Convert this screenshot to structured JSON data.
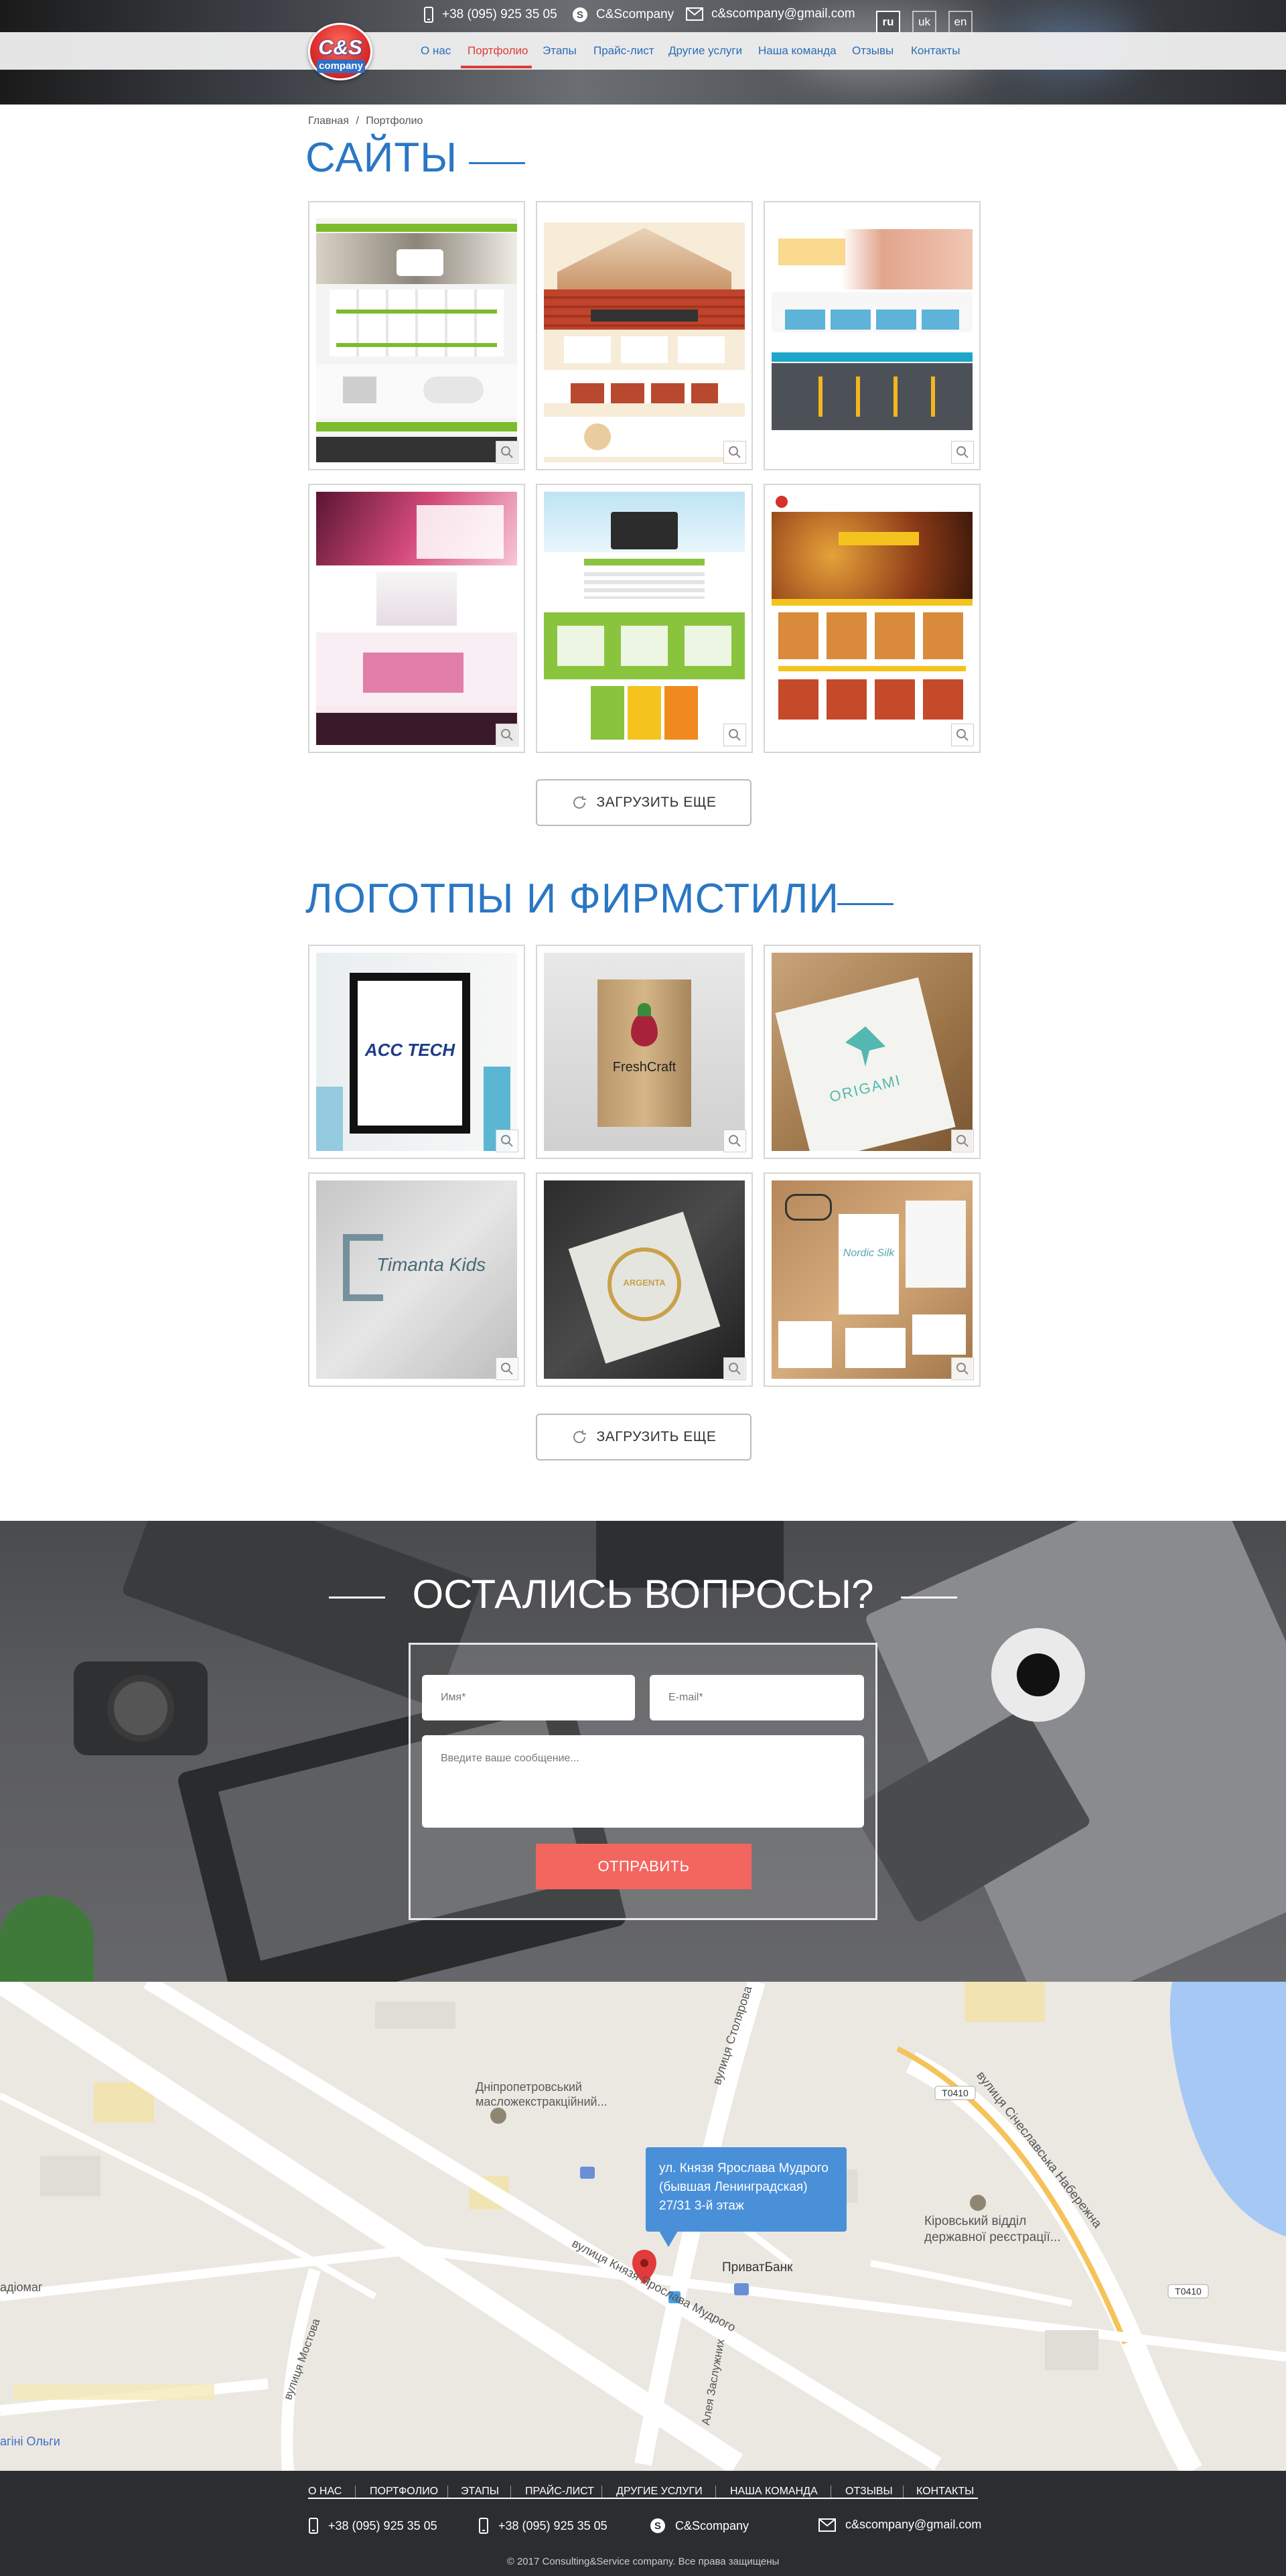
{
  "header": {
    "phone": "+38 (095) 925 35 05",
    "skype": "C&Scompany",
    "email": "c&scompany@gmail.com",
    "languages": [
      "ru",
      "uk",
      "en"
    ],
    "active_language": "ru",
    "logo_text": "C&S",
    "logo_subtext": "company",
    "nav": [
      "О нас",
      "Портфолио",
      "Этапы",
      "Прайс-лист",
      "Другие услуги",
      "Наша команда",
      "Отзывы",
      "Контакты"
    ],
    "active_nav": "Портфолио"
  },
  "breadcrumb": {
    "home": "Главная",
    "separator": "/",
    "current": "Портфолио"
  },
  "sites_section": {
    "title": "САЙТЫ",
    "load_more": "ЗАГРУЗИТЬ ЕЩЕ"
  },
  "logos_section": {
    "title": "ЛОГОТПЫ И ФИРМСТИЛИ",
    "load_more": "ЗАГРУЗИТЬ ЕЩЕ",
    "items": [
      "ACC TECH",
      "FreshCraft",
      "ORIGAMI",
      "Timanta Kids",
      "ARGENTA",
      "Nordic Silk"
    ]
  },
  "contact": {
    "title": "ОСТАЛИСЬ ВОПРОСЫ?",
    "name_placeholder": "Имя*",
    "email_placeholder": "E-mail*",
    "message_placeholder": "Введите ваше сообщение...",
    "submit": "ОТПРАВИТЬ"
  },
  "map": {
    "tooltip_line1": "ул. Князя Ярослава Мудрого",
    "tooltip_line2": "(бывшая Ленинградская)",
    "tooltip_line3": "27/31 3-й этаж",
    "labels": {
      "oil_plant": "Дніпропетровський масложекстракційний...",
      "privatbank": "ПриватБанк",
      "kirov": "Кіровський відділ державної реєстрації...",
      "street1": "вулиця Князя Ярослава Мудрого",
      "street2": "вулиця Столярова",
      "street3": "вулиця Січеславська Набережна",
      "street4": "вулиця Мостова",
      "street5": "Алея Заслужних",
      "radiomag": "адіомаг",
      "olga": "агіні Ольги",
      "road": "T0410"
    }
  },
  "footer": {
    "nav": [
      "О НАС",
      "ПОРТФОЛИО",
      "ЭТАПЫ",
      "ПРАЙС-ЛИСТ",
      "ДРУГИЕ УСЛУГИ",
      "НАША КОМАНДА",
      "ОТЗЫВЫ",
      "КОНТАКТЫ"
    ],
    "phone1": "+38 (095) 925 35 05",
    "phone2": "+38 (095) 925 35 05",
    "skype": "C&Scompany",
    "email": "c&scompany@gmail.com",
    "copyright": "© 2017 Consulting&Service company. Все права защищены"
  },
  "colors": {
    "accent_blue": "#2a77c4",
    "nav_active_red": "#e03a3a",
    "submit_red": "#f2665f",
    "footer_dark": "#2c2d30"
  }
}
